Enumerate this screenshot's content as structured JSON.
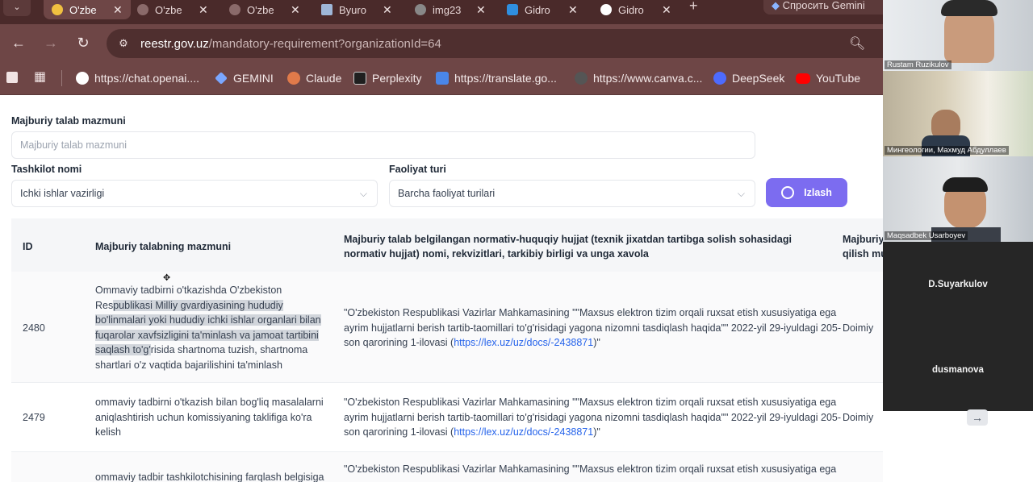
{
  "browser": {
    "tabs": [
      {
        "title": "O'zbe",
        "active": true,
        "fav_color": "#f0c040"
      },
      {
        "title": "O'zbe",
        "active": false,
        "fav_color": "#caa"
      },
      {
        "title": "O'zbe",
        "active": false,
        "fav_color": "#caa"
      },
      {
        "title": "Byuro",
        "active": false,
        "fav_color": "#9fb7d8"
      },
      {
        "title": "img23",
        "active": false,
        "fav_color": "#888"
      },
      {
        "title": "Gidro",
        "active": false,
        "fav_color": "#2f8fe0"
      },
      {
        "title": "Gidro",
        "active": false,
        "fav_color": "#ffffff"
      }
    ],
    "gemini_label": "Спросить Gemini",
    "url_host": "reestr.gov.uz",
    "url_path": "/mandatory-requirement?organizationId=64",
    "bookmarks": [
      {
        "label": "https://chat.openai....",
        "color": "#ffffff"
      },
      {
        "label": "GEMINI",
        "color": "#7aa7ff"
      },
      {
        "label": "Claude",
        "color": "#e07a4a"
      },
      {
        "label": "Perplexity",
        "color": "#1f1f1f"
      },
      {
        "label": "https://translate.go...",
        "color": "#4a86e8"
      },
      {
        "label": "https://www.canva.c...",
        "color": "#555555"
      },
      {
        "label": "DeepSeek",
        "color": "#4d6bfe"
      },
      {
        "label": "YouTube",
        "color": "#ff0000"
      }
    ]
  },
  "filters": {
    "content_label": "Majburiy talab mazmuni",
    "content_placeholder": "Majburiy talab mazmuni",
    "org_label": "Tashkilot nomi",
    "org_value": "Ichki ishlar vazirligi",
    "activity_label": "Faoliyat turi",
    "activity_value": "Barcha faoliyat turilari",
    "search_button": "Izlash"
  },
  "table": {
    "headers": {
      "id": "ID",
      "content": "Majburiy talabning mazmuni",
      "document": "Majburiy talab belgilangan normativ-huquqiy hujjat (texnik jixatdan tartibga solish sohasidagi normativ hujjat) nomi, rekvizitlari, tarkibiy birligi va unga xavola",
      "term_l1": "Majburiy",
      "term_l2": "qilish mu"
    },
    "rows": [
      {
        "id": "2480",
        "c1": "Ommaviy tadbirni o'tkazishda O'zbekiston",
        "c2a": "Res",
        "c2b": "publikasi Milliy gvardiyasining hududiy",
        "c3": "bo'linmalari yoki hududiy ichki ishlar organlari bilan",
        "c4": "fuqarolar xavfsizligini ta'minlash va jamoat tartibini",
        "c5a": "saqlash to'g'",
        "c5b": "risida shartnoma tuzish, shartnoma",
        "c6": "shartlari o'z vaqtida bajarilishini ta'minlash",
        "d1": "\"O'zbekiston Respublikasi Vazirlar Mahkamasining \"\"Maxsus elektron tizim orqali ruxsat etish xususiyatiga ega",
        "d2": "ayrim hujjatlarni berish tartib-taomillari to'g'risidagi yagona nizomni tasdiqlash haqida\"\" 2022-yil 29-iyuldagi 205-",
        "d3a": "son qarorining 1-ilovasi (",
        "link": "https://lex.uz/uz/docs/-2438871",
        "d3b": ")\"",
        "term": "Doimiy"
      },
      {
        "id": "2479",
        "c1": "ommaviy tadbirni o'tkazish bilan bog'liq masalalarni",
        "c2": "aniqlashtirish uchun komissiyaning taklifiga ko'ra",
        "c3": "kelish",
        "d1": "\"O'zbekiston Respublikasi Vazirlar Mahkamasining \"\"Maxsus elektron tizim orqali ruxsat etish xususiyatiga ega",
        "d2": "ayrim hujjatlarni berish tartib-taomillari to'g'risidagi yagona nizomni tasdiqlash haqida\"\" 2022-yil 29-iyuldagi 205-",
        "d3a": "son qarorining 1-ilovasi (",
        "link": "https://lex.uz/uz/docs/-2438871",
        "d3b": ")\"",
        "term": "Doimiy"
      },
      {
        "c1": "ommaviy tadbir tashkilotchisining farqlash belgisiga",
        "d1": "\"O'zbekiston Respublikasi Vazirlar Mahkamasining \"\"Maxsus elektron tizim orqali ruxsat etish xususiyatiga ega"
      }
    ],
    "row_arrow": "→"
  },
  "video_call": {
    "participants": [
      {
        "name": "Rustam Ruzikulov"
      },
      {
        "name": "Мингеологии, Махмуд Абдуллаев"
      },
      {
        "name": "Maqsadbek Usarboyev"
      },
      {
        "name": "D.Suyarkulov"
      },
      {
        "name": "dusmanova"
      }
    ]
  }
}
